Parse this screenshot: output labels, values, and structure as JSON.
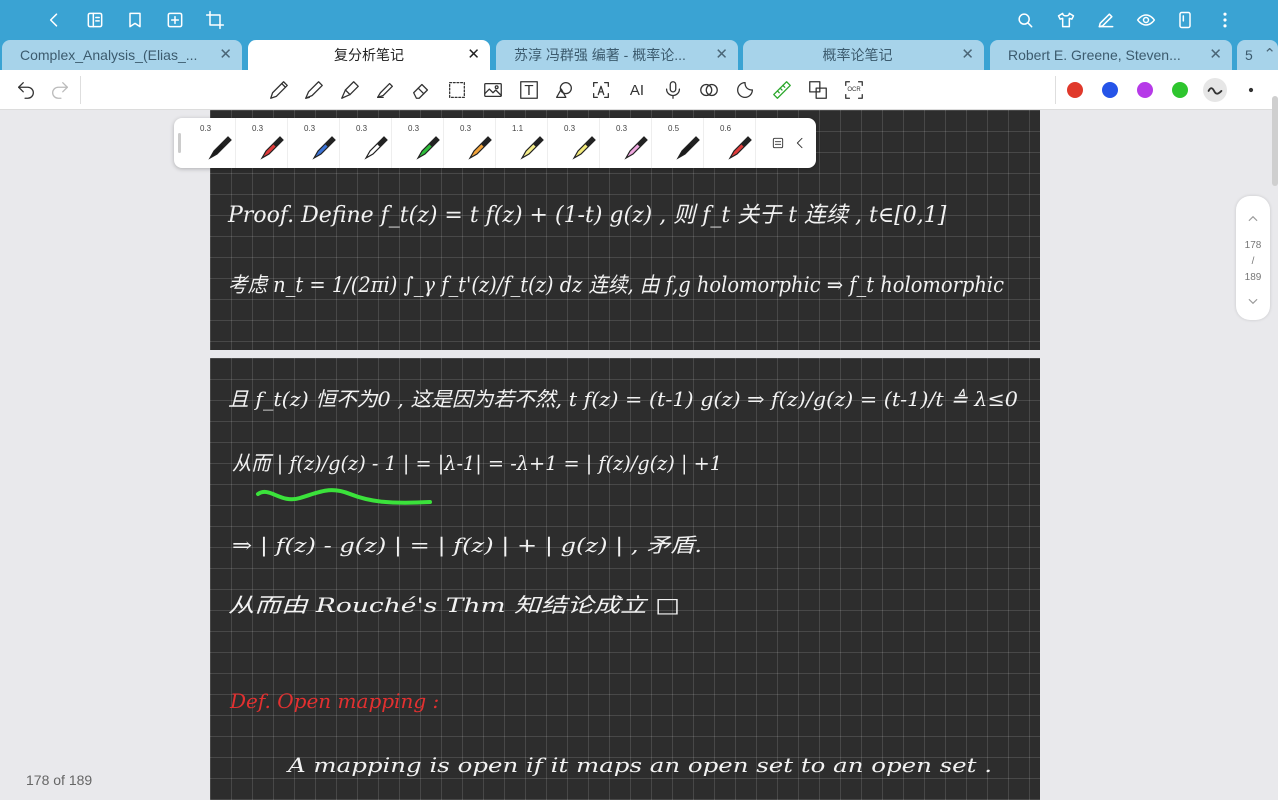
{
  "topbar": {
    "left_icons": [
      "back-icon",
      "outline-icon",
      "bookmark-icon",
      "add-page-icon",
      "crop-icon"
    ],
    "right_icons": [
      "search-icon",
      "shirt-icon",
      "pen-edit-icon",
      "eye-icon",
      "phone-icon",
      "more-icon"
    ]
  },
  "tabs": [
    {
      "label": "Complex_Analysis_(Elias_...",
      "close": "✕"
    },
    {
      "label": "复分析笔记",
      "close": "✕",
      "active": true
    },
    {
      "label": "苏淳 冯群强 编著 - 概率论...",
      "close": "✕"
    },
    {
      "label": "概率论笔记",
      "close": "✕"
    },
    {
      "label": "Robert E. Greene, Steven...",
      "close": "✕"
    },
    {
      "label": "5",
      "close": "⌃"
    }
  ],
  "toolbar": {
    "undo_icon": "undo-icon",
    "redo_icon": "redo-icon",
    "tools": [
      "pencil-icon",
      "pen-icon",
      "fountain-pen-icon",
      "highlighter-icon",
      "eraser-icon",
      "lasso-icon",
      "image-icon",
      "textbox-icon",
      "shapes-icon",
      "text-recognition-icon",
      "ai-icon",
      "microphone-icon",
      "link-icon",
      "sticker-icon",
      "ruler-icon",
      "translate-icon",
      "ocr-icon"
    ],
    "textbox_label": "T",
    "ai_label": "AI",
    "ocr_label": "OCR",
    "colors": [
      "#e0392b",
      "#2554e8",
      "#b63ae8",
      "#2ec52e"
    ],
    "stroke_icon": "stroke-style-icon",
    "dot_icon": "stroke-size-icon"
  },
  "pens": [
    {
      "size": "0.3",
      "color": "#1a1a1a"
    },
    {
      "size": "0.3",
      "color": "#e03a3a"
    },
    {
      "size": "0.3",
      "color": "#3b73d6"
    },
    {
      "size": "0.3",
      "color": "#ffffff"
    },
    {
      "size": "0.3",
      "color": "#2dbf3a"
    },
    {
      "size": "0.3",
      "color": "#f2a33a"
    },
    {
      "size": "1.1",
      "color": "#f6ee8a"
    },
    {
      "size": "0.3",
      "color": "#f3ea7a"
    },
    {
      "size": "0.3",
      "color": "#f0a8e0"
    },
    {
      "size": "0.5",
      "color": "#1a1a1a"
    },
    {
      "size": "0.6",
      "color": "#e03a3a"
    }
  ],
  "page1": {
    "line1": "Proof. Define  f_t(z) = t f(z) + (1-t) g(z) , 则 f_t 关于 t 连续 ,   t∈[0,1]",
    "line2": "考虑  n_t = 1/(2πi) ∫_γ f_t'(z)/f_t(z) dz   连续,  由 f,g holomorphic ⇒ f_t  holomorphic"
  },
  "page2": {
    "line1": "且 f_t(z) 恒不为0 , 这是因为若不然,   t f(z) = (t-1) g(z)  ⇒  f(z)/g(z) = (t-1)/t ≜ λ≤0",
    "line2": "从而 | f(z)/g(z) - 1 | = |λ-1| = -λ+1 = | f(z)/g(z) | +1",
    "line3": "⇒  | f(z) - g(z) | = | f(z) | + | g(z) |  , 矛盾.",
    "line4": "从而由 Rouché's  Thm 知结论成立        □",
    "def_title": "Def. Open mapping :",
    "def_body": "A mapping is open if it maps an open set to an open set ."
  },
  "scroller": {
    "current": "178",
    "sep": "/",
    "total": "189"
  },
  "page_counter": "178 of 189"
}
